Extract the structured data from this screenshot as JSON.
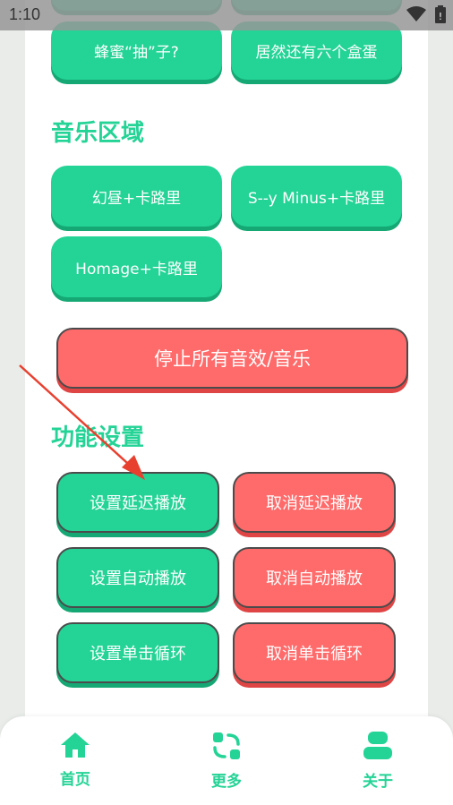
{
  "status_bar": {
    "time": "1:10"
  },
  "sounds": {
    "row0_left": "",
    "row0_right": "",
    "bee": "蜂蜜“抽”子?",
    "eggs": "居然还有六个盒蛋"
  },
  "music": {
    "title": "音乐区域",
    "items": [
      "幻昼+卡路里",
      "S--y Minus+卡路里",
      "Homage+卡路里"
    ]
  },
  "stop_all": "停止所有音效/音乐",
  "features": {
    "title": "功能设置",
    "set_delay": "设置延迟播放",
    "cancel_delay": "取消延迟播放",
    "set_auto": "设置自动播放",
    "cancel_auto": "取消自动播放",
    "set_loop": "设置单击循环",
    "cancel_loop": "取消单击循环"
  },
  "tabs": {
    "home": "首页",
    "more": "更多",
    "about": "关于"
  },
  "colors": {
    "green": "#24d396",
    "red": "#ff6a6a",
    "arrow": "#e8402f"
  }
}
